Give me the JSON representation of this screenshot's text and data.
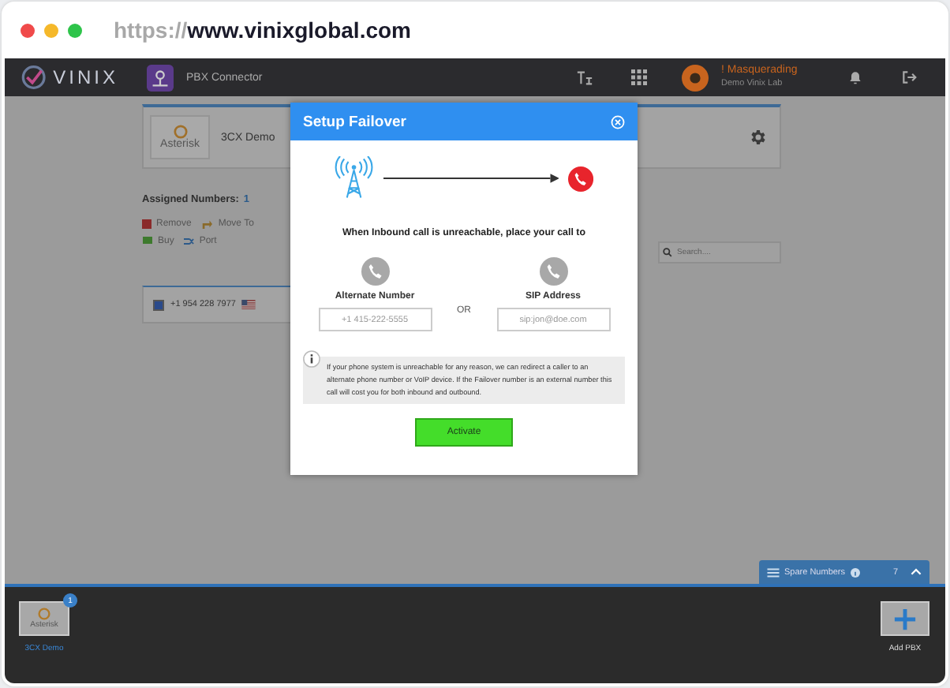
{
  "browser": {
    "url_scheme": "https://",
    "url_host": "www.vinixglobal.com"
  },
  "header": {
    "logo": "VINIX",
    "app": "PBX Connector",
    "user": {
      "status": "! Masquerading",
      "account": "Demo Vinix Lab"
    }
  },
  "pbx_card": {
    "logo_text": "Asterisk",
    "name": "3CX Demo"
  },
  "assigned": {
    "label": "Assigned Numbers:",
    "count": "1"
  },
  "actions": [
    {
      "kind": "remove",
      "label": "Remove"
    },
    {
      "kind": "move",
      "label": "Move To"
    },
    {
      "kind": "buy",
      "label": "Buy"
    },
    {
      "kind": "port",
      "label": "Port"
    }
  ],
  "search": {
    "placeholder": "Search...."
  },
  "numbers": [
    {
      "number": "+1 954 228 7977",
      "checked": true
    }
  ],
  "dialog": {
    "title": "Setup Failover",
    "heading": "When Inbound call is unreachable, place your call to",
    "options": [
      {
        "label": "Alternate Number",
        "placeholder": "+1 415-222-5555"
      },
      {
        "label": "SIP Address",
        "placeholder": "sip:jon@doe.com"
      }
    ],
    "separator": "OR",
    "info": "If your phone system is unreachable for any reason, we can redirect a caller to an alternate phone number or VoIP device. If the Failover number is an external number this call will cost you for both inbound and outbound.",
    "button": "Activate"
  },
  "spare_numbers": {
    "label": "Spare Numbers",
    "count": "7"
  },
  "dock": {
    "pbxs": [
      {
        "logo_text": "Asterisk",
        "name": "3CX Demo",
        "badge": "1"
      }
    ],
    "add_label": "Add PBX"
  }
}
